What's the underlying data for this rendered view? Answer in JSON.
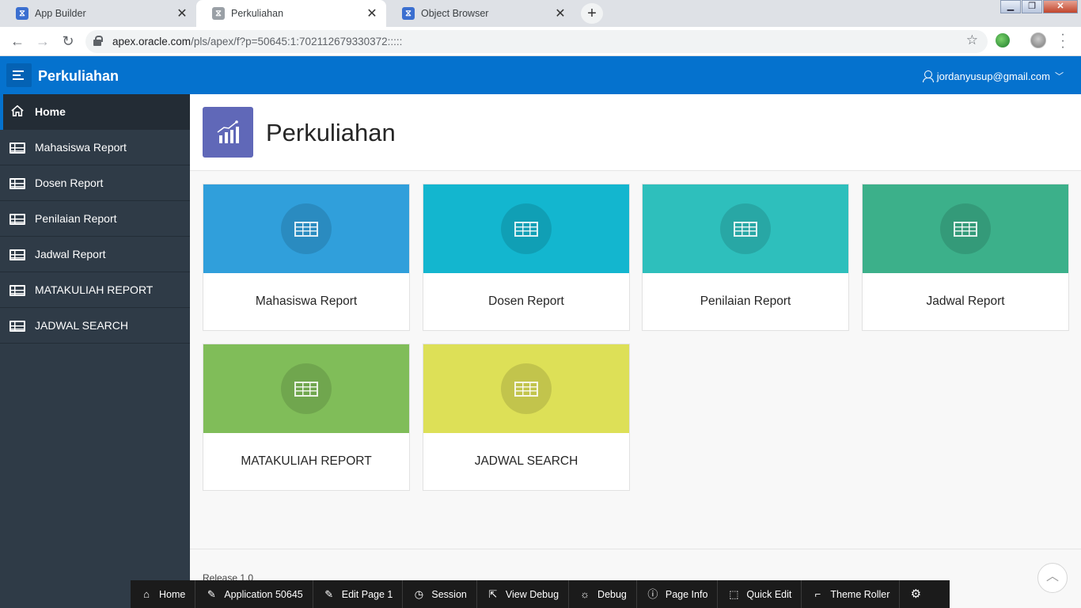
{
  "browser": {
    "tabs": [
      {
        "title": "App Builder"
      },
      {
        "title": "Perkuliahan"
      },
      {
        "title": "Object Browser"
      }
    ],
    "url_host": "apex.oracle.com",
    "url_path": "/pls/apex/f?p=50645:1:702112679330372:::::"
  },
  "header": {
    "app_title": "Perkuliahan",
    "user": "jordanyusup@gmail.com"
  },
  "sidebar": {
    "items": [
      {
        "label": "Home"
      },
      {
        "label": "Mahasiswa Report"
      },
      {
        "label": "Dosen Report"
      },
      {
        "label": "Penilaian Report"
      },
      {
        "label": "Jadwal Report"
      },
      {
        "label": "MATAKULIAH REPORT"
      },
      {
        "label": "JADWAL SEARCH"
      }
    ]
  },
  "main": {
    "title": "Perkuliahan",
    "cards": [
      {
        "label": "Mahasiswa Report",
        "color": "#309fdb"
      },
      {
        "label": "Dosen Report",
        "color": "#13b6cf"
      },
      {
        "label": "Penilaian Report",
        "color": "#2ebfbc"
      },
      {
        "label": "Jadwal Report",
        "color": "#3cb08a"
      },
      {
        "label": "MATAKULIAH REPORT",
        "color": "#80bd59"
      },
      {
        "label": "JADWAL SEARCH",
        "color": "#dde057"
      }
    ],
    "release": "Release 1.0"
  },
  "devbar": {
    "items": [
      {
        "label": "Home",
        "icon": "home-icon"
      },
      {
        "label": "Application 50645",
        "icon": "edit-app-icon"
      },
      {
        "label": "Edit Page 1",
        "icon": "edit-page-icon"
      },
      {
        "label": "Session",
        "icon": "clock-icon"
      },
      {
        "label": "View Debug",
        "icon": "view-debug-icon"
      },
      {
        "label": "Debug",
        "icon": "bug-icon"
      },
      {
        "label": "Page Info",
        "icon": "info-icon"
      },
      {
        "label": "Quick Edit",
        "icon": "cursor-icon"
      },
      {
        "label": "Theme Roller",
        "icon": "paint-roller-icon"
      }
    ]
  }
}
